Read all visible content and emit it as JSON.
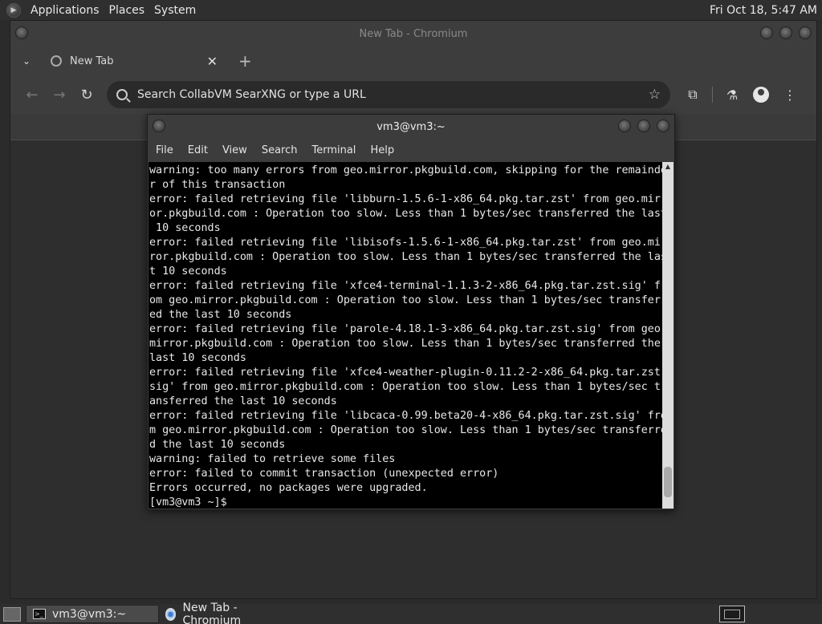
{
  "top_panel": {
    "menus": [
      "Applications",
      "Places",
      "System"
    ],
    "clock": "Fri Oct 18,  5:47 AM"
  },
  "chromium": {
    "window_title": "New Tab - Chromium",
    "tab": {
      "title": "New Tab"
    },
    "omnibox": {
      "placeholder": "Search CollabVM SearXNG or type a URL"
    }
  },
  "terminal": {
    "window_title": "vm3@vm3:~",
    "menu": [
      "File",
      "Edit",
      "View",
      "Search",
      "Terminal",
      "Help"
    ],
    "lines": [
      "warning: too many errors from geo.mirror.pkgbuild.com, skipping for the remainde",
      "r of this transaction",
      "error: failed retrieving file 'libburn-1.5.6-1-x86_64.pkg.tar.zst' from geo.mirr",
      "or.pkgbuild.com : Operation too slow. Less than 1 bytes/sec transferred the last",
      " 10 seconds",
      "error: failed retrieving file 'libisofs-1.5.6-1-x86_64.pkg.tar.zst' from geo.mir",
      "ror.pkgbuild.com : Operation too slow. Less than 1 bytes/sec transferred the las",
      "t 10 seconds",
      "error: failed retrieving file 'xfce4-terminal-1.1.3-2-x86_64.pkg.tar.zst.sig' fr",
      "om geo.mirror.pkgbuild.com : Operation too slow. Less than 1 bytes/sec transferr",
      "ed the last 10 seconds",
      "error: failed retrieving file 'parole-4.18.1-3-x86_64.pkg.tar.zst.sig' from geo.",
      "mirror.pkgbuild.com : Operation too slow. Less than 1 bytes/sec transferred the",
      "last 10 seconds",
      "error: failed retrieving file 'xfce4-weather-plugin-0.11.2-2-x86_64.pkg.tar.zst.",
      "sig' from geo.mirror.pkgbuild.com : Operation too slow. Less than 1 bytes/sec tr",
      "ansferred the last 10 seconds",
      "error: failed retrieving file 'libcaca-0.99.beta20-4-x86_64.pkg.tar.zst.sig' fro",
      "m geo.mirror.pkgbuild.com : Operation too slow. Less than 1 bytes/sec transferre",
      "d the last 10 seconds",
      "warning: failed to retrieve some files",
      "error: failed to commit transaction (unexpected error)",
      "Errors occurred, no packages were upgraded.",
      "[vm3@vm3 ~]$ "
    ]
  },
  "taskbar": {
    "tasks": [
      {
        "label": "vm3@vm3:~",
        "icon": "terminal-icon"
      },
      {
        "label": "New Tab - Chromium",
        "icon": "chromium-icon"
      }
    ]
  }
}
